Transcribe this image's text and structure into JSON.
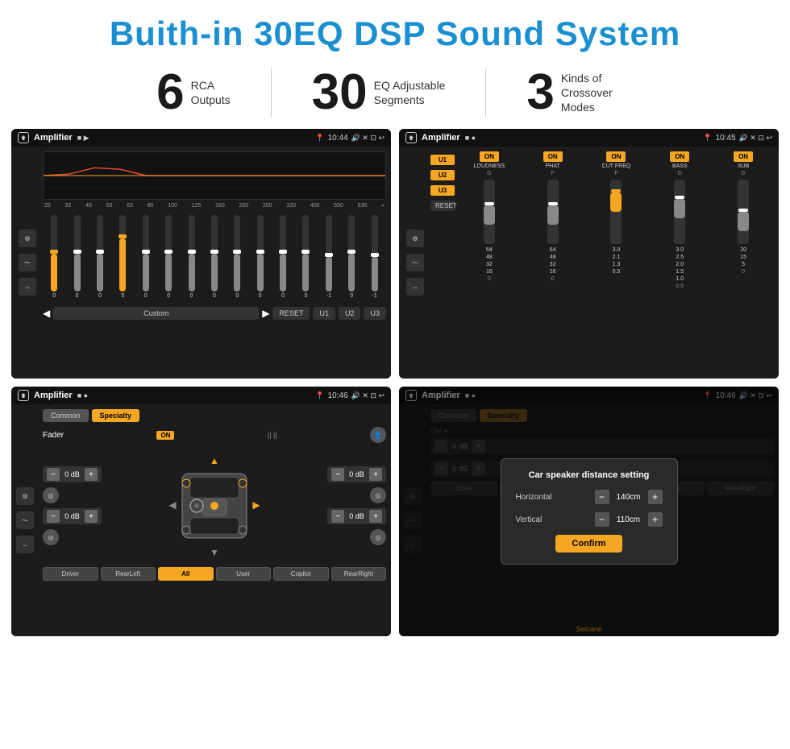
{
  "header": {
    "title": "Buith-in 30EQ DSP Sound System",
    "title_color": "#1a8fd1"
  },
  "stats": [
    {
      "number": "6",
      "label": "RCA\nOutputs"
    },
    {
      "number": "30",
      "label": "EQ Adjustable\nSegments"
    },
    {
      "number": "3",
      "label": "Kinds of\nCrossover Modes"
    }
  ],
  "screen1": {
    "app_title": "Amplifier",
    "time": "10:44",
    "freq_labels": [
      "25",
      "32",
      "40",
      "50",
      "63",
      "80",
      "100",
      "125",
      "160",
      "200",
      "250",
      "320",
      "400",
      "500",
      "630"
    ],
    "slider_values": [
      "0",
      "0",
      "0",
      "5",
      "0",
      "0",
      "0",
      "0",
      "0",
      "0",
      "0",
      "0",
      "-1",
      "0",
      "-1"
    ],
    "controls": [
      "◀",
      "Custom",
      "▶",
      "RESET",
      "U1",
      "U2",
      "U3"
    ]
  },
  "screen2": {
    "app_title": "Amplifier",
    "time": "10:45",
    "presets": [
      "U1",
      "U2",
      "U3",
      "RESET"
    ],
    "columns": [
      "LOUDNESS",
      "PHAT",
      "CUT FREQ",
      "BASS",
      "SUB"
    ],
    "toggles": [
      "ON",
      "ON",
      "ON",
      "ON",
      "ON"
    ]
  },
  "screen3": {
    "app_title": "Amplifier",
    "time": "10:46",
    "tabs": [
      "Common",
      "Specialty"
    ],
    "fader_label": "Fader",
    "fader_on": "ON",
    "positions": [
      {
        "label": "Driver",
        "value": "0 dB"
      },
      {
        "label": "Copilot",
        "value": "0 dB"
      },
      {
        "label": "RearLeft",
        "value": "0 dB"
      },
      {
        "label": "RearRight",
        "value": "0 dB"
      },
      {
        "label": "All",
        "active": true
      }
    ],
    "bottom_btns": [
      "Driver",
      "RearLeft",
      "All",
      "User",
      "Copilot",
      "RearRight"
    ]
  },
  "screen4": {
    "app_title": "Amplifier",
    "time": "10:46",
    "tabs": [
      "Common",
      "Specialty"
    ],
    "dialog": {
      "title": "Car speaker distance setting",
      "horizontal_label": "Horizontal",
      "horizontal_value": "140cm",
      "vertical_label": "Vertical",
      "vertical_value": "110cm",
      "confirm_label": "Confirm"
    },
    "bottom_right_dbs": [
      "0 dB",
      "0 dB"
    ],
    "bottom_btns_right": [
      "Copilot",
      "RearRight"
    ]
  },
  "watermark": "Seicane"
}
